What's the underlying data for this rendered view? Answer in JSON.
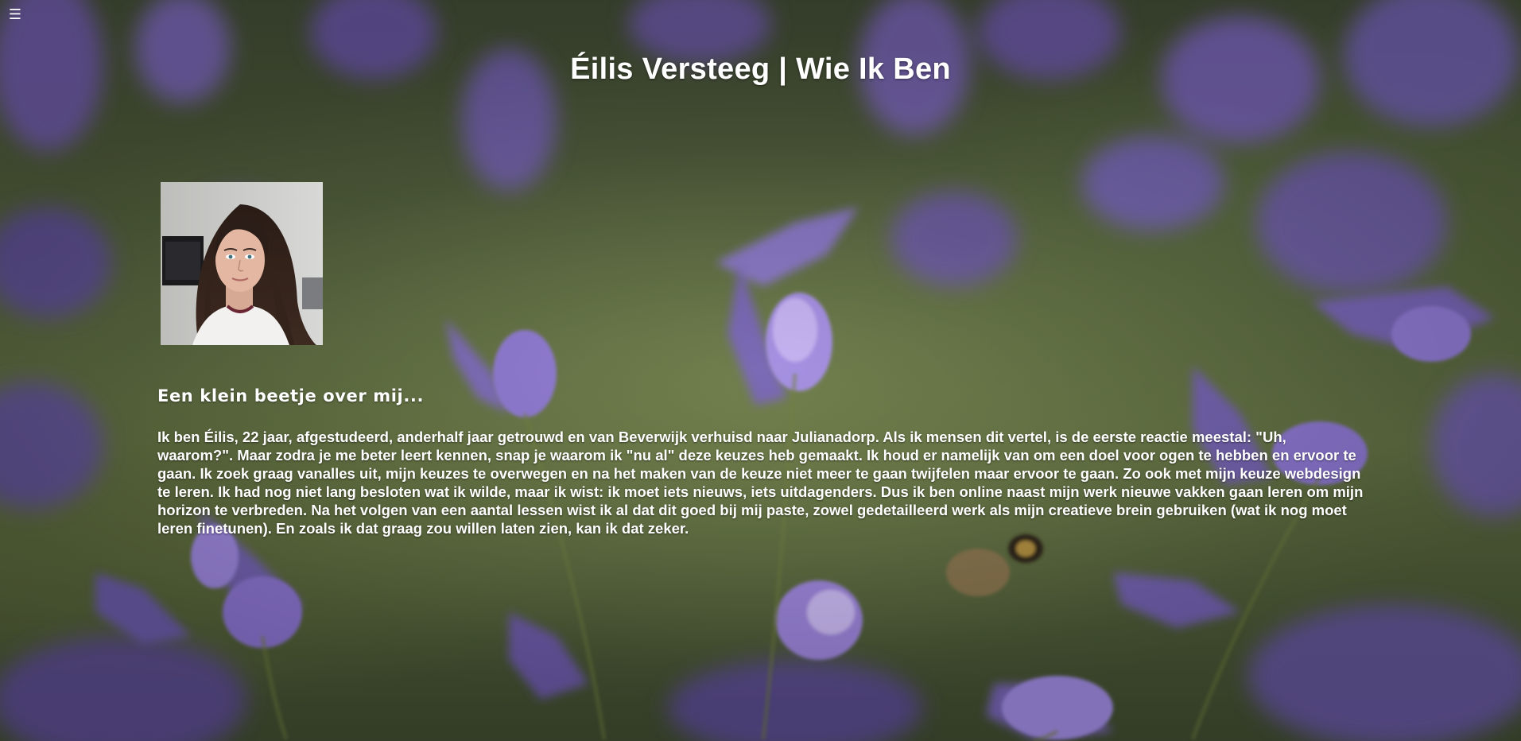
{
  "menu": {
    "icon": "hamburger-icon",
    "glyph": "☰"
  },
  "header": {
    "title": "Éilis Versteeg | Wie Ik Ben"
  },
  "portrait": {
    "alt": "Éilis"
  },
  "about": {
    "heading": "Een klein beetje over mij...",
    "text": "Ik ben Éilis, 22 jaar, afgestudeerd, anderhalf jaar getrouwd en van Beverwijk verhuisd naar Julianadorp. Als ik mensen dit vertel, is de eerste reactie meestal: \"Uh, waarom?\". Maar zodra je me beter leert kennen, snap je waarom ik \"nu al\" deze keuzes heb gemaakt. Ik houd er namelijk van om een doel voor ogen te hebben en ervoor te gaan. Ik zoek graag vanalles uit, mijn keuzes te overwegen en na het maken van de keuze niet meer te gaan twijfelen maar ervoor te gaan. Zo ook met mijn keuze webdesign te leren. Ik had nog niet lang besloten wat ik wilde, maar ik wist: ik moet iets nieuws, iets uitdagenders. Dus ik ben online naast mijn werk nieuwe vakken gaan leren om mijn horizon te verbreden. Na het volgen van een aantal lessen wist ik al dat dit goed bij mij paste, zowel gedetailleerd werk als mijn creatieve brein gebruiken (wat ik nog moet leren finetunen). En zoals ik dat graag zou willen laten zien, kan ik dat zeker."
  },
  "colors": {
    "text": "#ffffff",
    "lavender": "#8a6fc9",
    "foliage": "#5c6a3b"
  }
}
